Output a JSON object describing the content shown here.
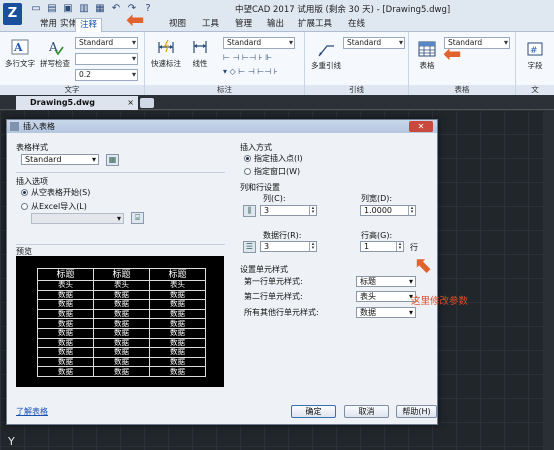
{
  "window": {
    "title": "中望CAD 2017 试用版 (剩余 30 天) - [Drawing5.dwg]",
    "app_logo_letter": "Z"
  },
  "ribbon_tabs": [
    "常用",
    "实体",
    "注释",
    "视图",
    "工具",
    "管理",
    "输出",
    "扩展工具",
    "在线"
  ],
  "active_tab": "注释",
  "ribbon": {
    "text_group": {
      "label": "文字",
      "multiline_text": "多行文字",
      "spell_check": "拼写检查",
      "style_combo": "Standard",
      "height_combo": "0.2"
    },
    "dim_group": {
      "label": "标注",
      "quick_dim": "快速标注",
      "linear": "线性",
      "style_combo": "Standard"
    },
    "leader_group": {
      "label": "引线",
      "multileader": "多重引线",
      "style_combo": "Standard"
    },
    "table_group": {
      "label": "表格",
      "table": "表格",
      "style_combo": "Standard"
    },
    "field_group": {
      "label": "文",
      "field": "字段"
    }
  },
  "doc_tab": {
    "name": "Drawing5.dwg",
    "close": "×"
  },
  "dialog": {
    "title": "插入表格",
    "close": "✕",
    "table_style_label": "表格样式",
    "table_style_value": "Standard",
    "insert_options_label": "插入选项",
    "from_empty": "从空表格开始(S)",
    "from_excel": "从Excel导入(L)",
    "preview_label": "预览",
    "insert_method_label": "插入方式",
    "specify_point": "指定插入点(I)",
    "specify_window": "指定窗口(W)",
    "col_row_label": "列和行设置",
    "columns_label": "列(C):",
    "columns_value": "3",
    "col_width_label": "列宽(D):",
    "col_width_value": "1.0000",
    "data_rows_label": "数据行(R):",
    "data_rows_value": "3",
    "row_height_label": "行高(G):",
    "row_height_value": "1",
    "row_unit": "行",
    "cell_style_label": "设置单元样式",
    "first_row_label": "第一行单元样式:",
    "first_row_value": "标题",
    "second_row_label": "第二行单元样式:",
    "second_row_value": "表头",
    "other_rows_label": "所有其他行单元样式:",
    "other_rows_value": "数据",
    "learn_link": "了解表格",
    "ok": "确定",
    "cancel": "取消",
    "help": "帮助(H)"
  },
  "preview_table": {
    "title_row": [
      "标题",
      "标题",
      "标题"
    ],
    "header_row": [
      "表头",
      "表头",
      "表头"
    ],
    "data_rows": [
      [
        "数据",
        "数据",
        "数据"
      ],
      [
        "数据",
        "数据",
        "数据"
      ],
      [
        "数据",
        "数据",
        "数据"
      ],
      [
        "数据",
        "数据",
        "数据"
      ],
      [
        "数据",
        "数据",
        "数据"
      ],
      [
        "数据",
        "数据",
        "数据"
      ],
      [
        "数据",
        "数据",
        "数据"
      ],
      [
        "数据",
        "数据",
        "数据"
      ],
      [
        "数据",
        "数据",
        "数据"
      ]
    ]
  },
  "annotation_text": "这里修改参数",
  "colors": {
    "accent": "#1a57b8",
    "annotation": "#e04a26",
    "canvas": "#21262b"
  }
}
